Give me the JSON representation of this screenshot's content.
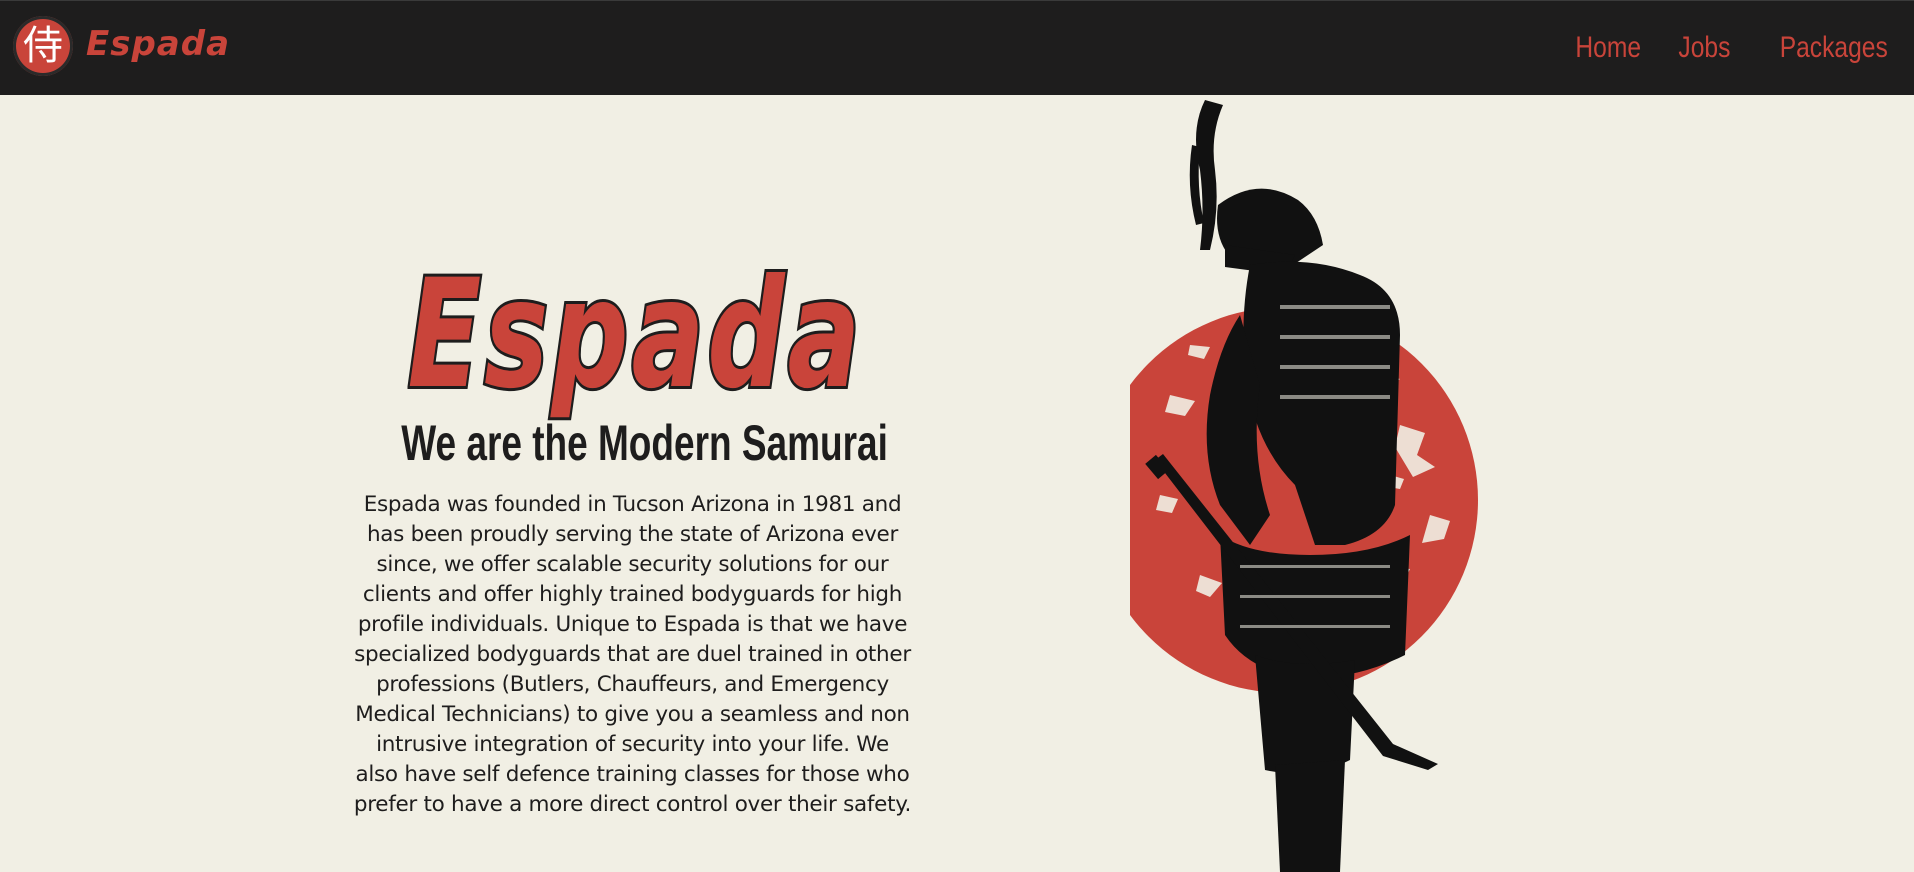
{
  "nav": {
    "brand": "Espada",
    "logo_glyph": "侍",
    "links": [
      "Home",
      "Jobs",
      "Packages"
    ]
  },
  "hero": {
    "title": "Espada",
    "subtitle": "We are the Modern Samurai",
    "body": "Espada was founded in Tucson Arizona in 1981 and has been proudly serving the state of Arizona ever since, we offer scalable security solutions for our clients and offer highly trained bodyguards for high profile individuals. Unique to Espada is that we have specialized bodyguards that are duel trained in other professions (Butlers, Chauffeurs, and Emergency Medical Technicians) to give you a seamless and non intrusive integration of security into your life. We also have self defence training classes for those who prefer to have a more direct control over their safety."
  },
  "illustration": {
    "icon": "samurai-illustration",
    "sun_color": "#c9443a"
  },
  "colors": {
    "accent": "#c9443a",
    "dark": "#1e1d1d",
    "background": "#f1efe4"
  }
}
